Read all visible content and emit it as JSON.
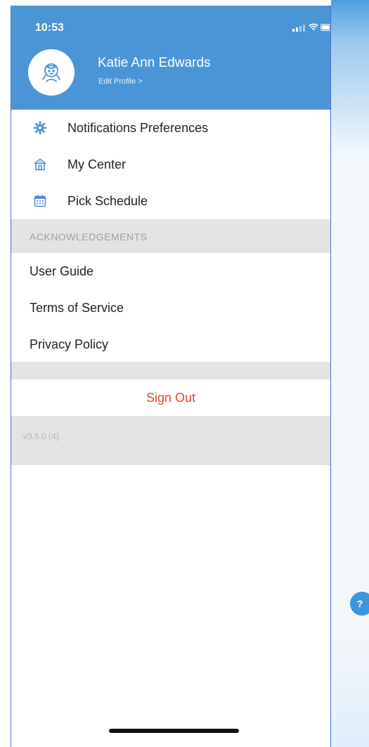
{
  "status_bar": {
    "time": "10:53"
  },
  "profile": {
    "name": "Katie Ann Edwards",
    "edit_label": "Edit Profile >"
  },
  "menu": {
    "items": [
      {
        "label": "Notifications Preferences",
        "icon": "gear-icon"
      },
      {
        "label": "My Center",
        "icon": "house-icon"
      },
      {
        "label": "Pick Schedule",
        "icon": "calendar-icon"
      }
    ]
  },
  "acknowledgements": {
    "header": "ACKNOWLEDGEMENTS",
    "items": [
      {
        "label": "User Guide"
      },
      {
        "label": "Terms of Service"
      },
      {
        "label": "Privacy Policy"
      }
    ]
  },
  "sign_out": {
    "label": "Sign Out"
  },
  "version": "v3.5.0 (4)",
  "help_button": {
    "label": "?"
  },
  "colors": {
    "header_blue": "#4b95d6",
    "sign_out_red": "#e1452b",
    "band_gray": "#e3e3e3",
    "icon_blue": "#4a90d9"
  }
}
